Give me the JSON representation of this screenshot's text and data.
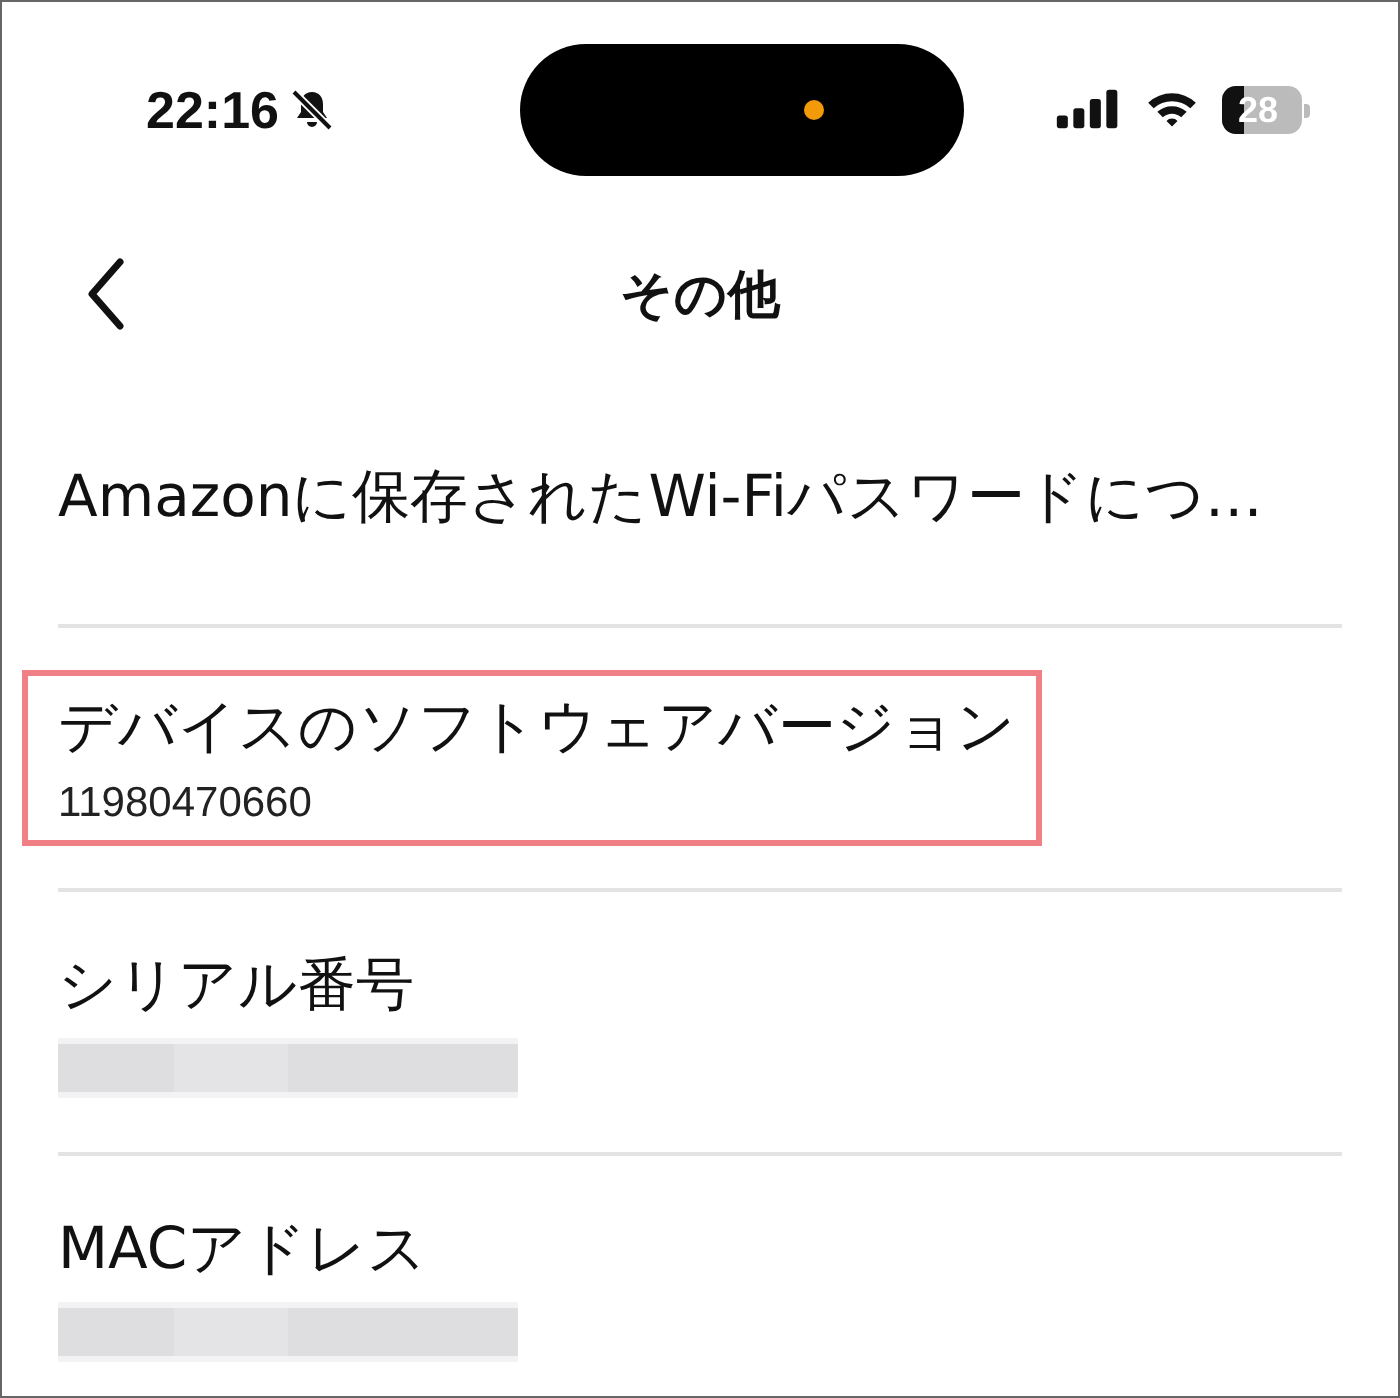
{
  "status_bar": {
    "time": "22:16",
    "silent": true,
    "battery": "28",
    "recording_dot": true
  },
  "nav": {
    "title": "その他"
  },
  "items": [
    {
      "kind": "plain",
      "title": "Amazonに保存されたWi-Fiパスワードにつ…",
      "highlighted": false
    },
    {
      "kind": "value",
      "title": "デバイスのソフトウェアバージョン",
      "value": "11980470660",
      "highlighted": true
    },
    {
      "kind": "redacted",
      "title": "シリアル番号",
      "highlighted": false
    },
    {
      "kind": "redacted",
      "title": "MACアドレス",
      "highlighted": false
    }
  ]
}
